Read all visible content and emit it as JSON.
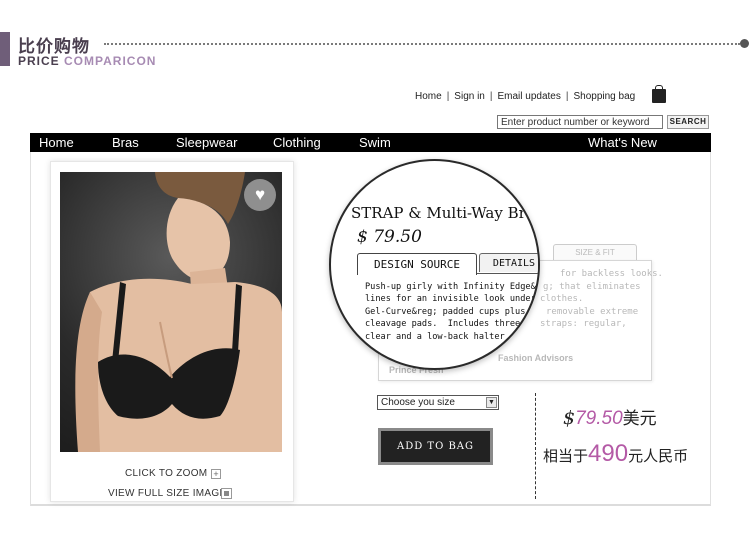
{
  "section_header": {
    "title_cn": "比价购物",
    "title_en_main": "PRICE ",
    "title_en_accent": "COMPARICON"
  },
  "top_links": [
    "Home",
    "Sign in",
    "Email updates",
    "Shopping bag"
  ],
  "search": {
    "placeholder": "Enter product number or keyword",
    "button_label": "SEARCH"
  },
  "nav": [
    {
      "label": "Home"
    },
    {
      "label": "Bras"
    },
    {
      "label": "Sleepwear"
    },
    {
      "label": "Clothing"
    },
    {
      "label": "Swim"
    },
    {
      "label": "What's New"
    }
  ],
  "image_panel": {
    "heart_icon": "♥",
    "zoom_label": "CLICK TO ZOOM",
    "zoom_icon": "+",
    "full_size_label": "VIEW FULL SIZE IMAGE"
  },
  "product": {
    "title": "STRAP & Multi-Way Br",
    "price": "$ 79.50",
    "tabs": [
      "DESIGN SOURCE",
      "DETAILS",
      "SIZE & FIT"
    ],
    "description": "Push-up girly with Infinity Edge&reg; that eliminates\nlines for an invisible look under clothes.\nGel-Curve&reg; padded cups plus removable extreme\ncleavage pads.  Includes three straps: regular,\nclear and a low-back halter.",
    "magnifier_desc": "Push-up girly with Infinity Edge&reg;\nlines for an invisible look under\nGel-Curve&reg; padded cups plus\ncleavage pads.  Includes three\nclear and a low-back halter",
    "faded_right": [
      "for backless looks.",
      "g; that eliminates",
      "clothes.",
      "removable extreme",
      "straps: regular,"
    ],
    "faded_advisor": "Fashion Advisors",
    "faded_prince": "Prince Fresh"
  },
  "size_select": {
    "selected": "Choose you  size",
    "arrow": "▼"
  },
  "add_to_bag": "ADD TO BAG",
  "price_compare": {
    "usd_symbol": "$",
    "usd_value": "79.50",
    "usd_unit": "美元",
    "rmb_prefix": "相当于",
    "rmb_value": "490",
    "rmb_unit": "元人民币"
  },
  "colors": {
    "accent_purple": "#b45aa6",
    "header_purple": "#6f5e79",
    "nav_bg": "#000000"
  }
}
